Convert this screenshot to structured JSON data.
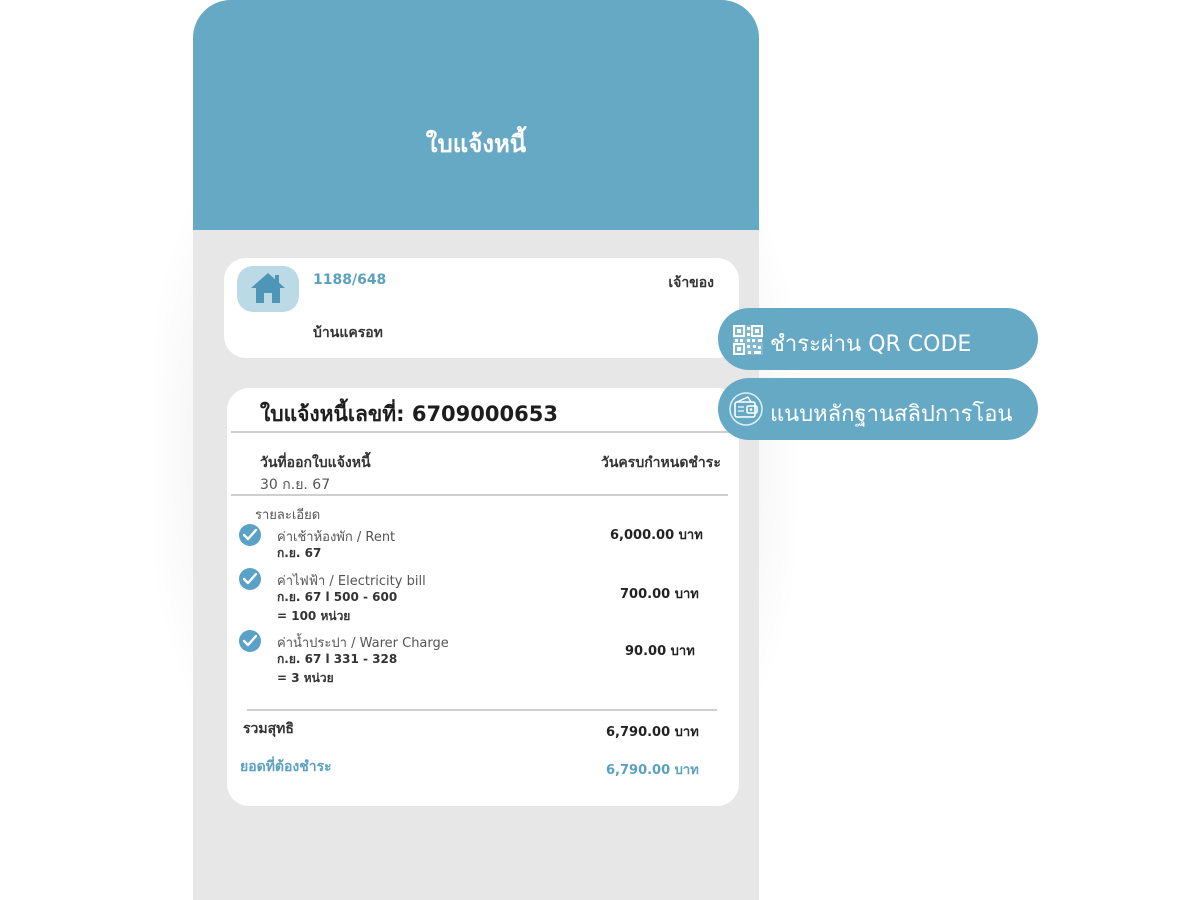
{
  "header": {
    "title": "ใบแจ้งหนี้"
  },
  "room": {
    "number": "1188/648",
    "role": "เจ้าของ",
    "name": "บ้านแครอท",
    "icon": "home-icon"
  },
  "invoice": {
    "title": "ใบแจ้งหนี้เลขที่: 6709000653",
    "issue_label": "วันที่ออกใบแจ้งหนี้",
    "issue_date": "30 ก.ย. 67",
    "due_label": "วันครบกำหนดชำระ",
    "details_label": "รายละเอียด",
    "items": [
      {
        "name": "ค่าเช้าห้องพัก / Rent",
        "line1": "ก.ย. 67",
        "line2": "",
        "amount": "6,000.00 บาท"
      },
      {
        "name": "ค่าไฟฟ้า / Electricity bill",
        "line1": "ก.ย. 67 l 500 - 600",
        "line2": "= 100 หน่วย",
        "amount": "700.00 บาท"
      },
      {
        "name": "ค่าน้ำประปา / Warer Charge",
        "line1": "ก.ย. 67 l 331 - 328",
        "line2": "= 3 หน่วย",
        "amount": "90.00 บาท"
      }
    ],
    "total_label": "รวมสุทธิ",
    "total_amount": "6,790.00 บาท",
    "due_amount_label": "ยอดที่ต้องชำระ",
    "due_amount": "6,790.00 บาท"
  },
  "actions": {
    "pay_qr_label": "ชำระผ่าน QR CODE",
    "attach_slip_label": "แนบหลักฐานสลิปการโอน"
  },
  "colors": {
    "accent": "#66a9c4",
    "accent_text": "#5aa1c0",
    "background": "#e7e7e7",
    "card": "#ffffff"
  }
}
